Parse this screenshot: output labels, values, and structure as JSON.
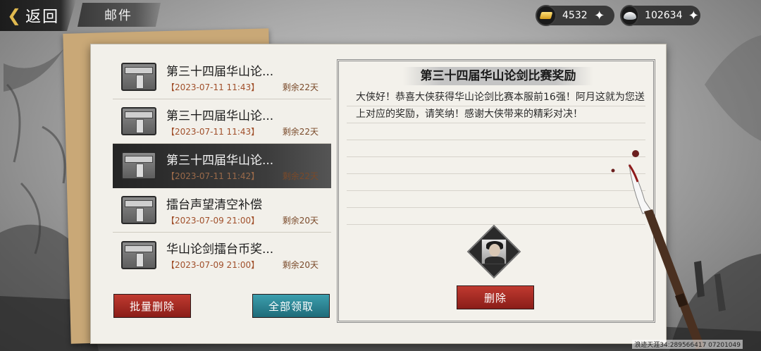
{
  "header": {
    "back_label": "返回",
    "title": "邮件"
  },
  "currencies": [
    {
      "icon": "gold-bar-icon",
      "value": "4532"
    },
    {
      "icon": "silver-ingot-icon",
      "value": "102634"
    }
  ],
  "mail_list": [
    {
      "title": "第三十四届华山论...",
      "date": "【2023-07-11 11:43】",
      "remaining": "剩余22天",
      "selected": false
    },
    {
      "title": "第三十四届华山论...",
      "date": "【2023-07-11 11:43】",
      "remaining": "剩余22天",
      "selected": false
    },
    {
      "title": "第三十四届华山论...",
      "date": "【2023-07-11 11:42】",
      "remaining": "剩余22天",
      "selected": true
    },
    {
      "title": "擂台声望清空补偿",
      "date": "【2023-07-09 21:00】",
      "remaining": "剩余20天",
      "selected": false
    },
    {
      "title": "华山论剑擂台币奖...",
      "date": "【2023-07-09 21:00】",
      "remaining": "剩余20天",
      "selected": false
    }
  ],
  "actions": {
    "batch_delete": "批量删除",
    "claim_all": "全部领取"
  },
  "detail": {
    "title": "第三十四届华山论剑比赛奖励",
    "body": "大侠好！恭喜大侠获得华山论剑比赛本服前16强！阿月这就为您送上对应的奖励，请笑纳！感谢大侠带来的精彩对决！",
    "delete_label": "删除"
  },
  "watermark": "浪迹天涯34:289566417 07201049"
}
